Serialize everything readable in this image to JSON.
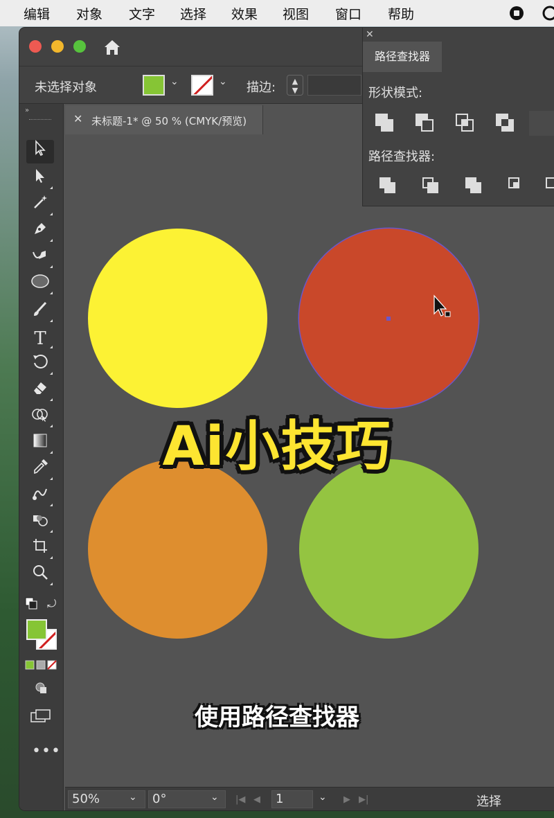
{
  "menubar": {
    "items": [
      "编辑",
      "对象",
      "文字",
      "选择",
      "效果",
      "视图",
      "窗口",
      "帮助"
    ]
  },
  "controlbar": {
    "no_selection": "未选择对象",
    "stroke_label": "描边:",
    "fill_color": "#86c535"
  },
  "document": {
    "tab_title": "未标题-1* @ 50 % (CMYK/预览)"
  },
  "tools": [
    "selection-tool",
    "direct-selection-tool",
    "magic-wand-tool",
    "pen-tool",
    "curvature-tool",
    "ellipse-tool",
    "paintbrush-tool",
    "type-tool",
    "rotate-tool",
    "eraser-tool",
    "shape-builder-tool",
    "gradient-tool",
    "eyedropper-tool",
    "blend-tool",
    "symbol-sprayer-tool",
    "artboard-tool",
    "zoom-tool"
  ],
  "canvas": {
    "circles": [
      {
        "name": "yellow-circle",
        "color": "#fcf234"
      },
      {
        "name": "red-circle",
        "color": "#c9482a",
        "selected": true
      },
      {
        "name": "orange-circle",
        "color": "#de8e2f"
      },
      {
        "name": "green-circle",
        "color": "#94c441"
      }
    ]
  },
  "pathfinder": {
    "tab": "路径查找器",
    "shape_modes_label": "形状模式:",
    "pathfinders_label": "路径查找器:"
  },
  "captions": {
    "title": "Ai小技巧",
    "subtitle": "使用路径查找器"
  },
  "statusbar": {
    "zoom": "50%",
    "rotation": "0°",
    "artboard": "1",
    "tool_name": "选择"
  }
}
